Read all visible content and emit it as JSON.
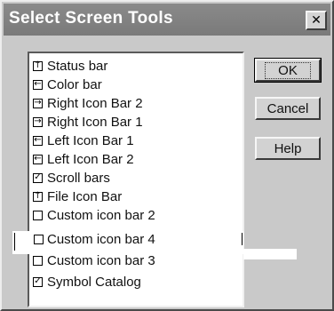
{
  "dialog": {
    "title": "Select Screen Tools",
    "close_glyph": "✕",
    "list": [
      {
        "label": "Status bar",
        "icon": "arrow-up-icon",
        "glyph": "↑"
      },
      {
        "label": "Color bar",
        "icon": "arrow-left-icon",
        "glyph": "←"
      },
      {
        "label": "Right Icon Bar 2",
        "icon": "arrow-right-icon",
        "glyph": "→"
      },
      {
        "label": "Right Icon Bar 1",
        "icon": "arrow-right-icon",
        "glyph": "→"
      },
      {
        "label": "Left Icon Bar 1",
        "icon": "arrow-left-icon",
        "glyph": "←"
      },
      {
        "label": "Left Icon Bar 2",
        "icon": "arrow-left-icon",
        "glyph": "←"
      },
      {
        "label": "Scroll bars",
        "icon": "checkbox-checked-icon",
        "glyph": "✓"
      },
      {
        "label": "File Icon Bar",
        "icon": "arrow-up-icon",
        "glyph": "↑"
      },
      {
        "label": "Custom icon bar 2",
        "icon": "checkbox-empty-icon",
        "glyph": ""
      },
      {
        "label": "Custom icon bar 4",
        "icon": "checkbox-empty-icon",
        "glyph": ""
      },
      {
        "label": "Custom icon bar 3",
        "icon": "checkbox-empty-icon",
        "glyph": ""
      },
      {
        "label": "Symbol Catalog",
        "icon": "checkbox-checked-icon",
        "glyph": "✓"
      }
    ],
    "buttons": {
      "ok": "OK",
      "cancel": "Cancel",
      "help": "Help"
    }
  }
}
